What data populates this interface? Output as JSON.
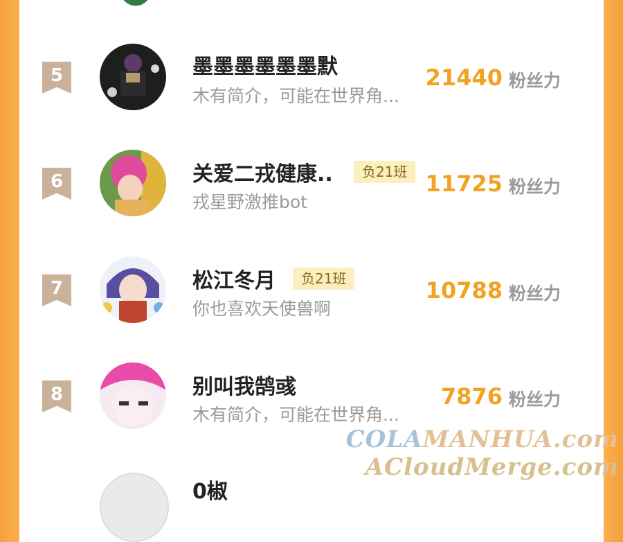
{
  "unit_label": "粉丝力",
  "rows": [
    {
      "rank": "5",
      "name": "墨墨墨墨墨墨默",
      "tag": "",
      "desc": "木有简介，可能在世界角...",
      "score": "21440"
    },
    {
      "rank": "6",
      "name": "关爱二戎健康..",
      "tag": "负21班",
      "desc": "戎星野激推bot",
      "score": "11725"
    },
    {
      "rank": "7",
      "name": "松江冬月",
      "tag": "负21班",
      "desc": "你也喜欢天使兽啊",
      "score": "10788"
    },
    {
      "rank": "8",
      "name": "别叫我鹄彧",
      "tag": "",
      "desc": "木有简介，可能在世界角...",
      "score": "7876"
    }
  ],
  "partial_next_name": "0椒",
  "watermark": {
    "line1_a": "COLA",
    "line1_b": "MANHUA.com",
    "line2": "ACloudMerge.com"
  },
  "colors": {
    "accent": "#f0a322",
    "frame": "#f9b04e",
    "badge": "#c9b19a",
    "tag_bg": "#fbefc0"
  }
}
